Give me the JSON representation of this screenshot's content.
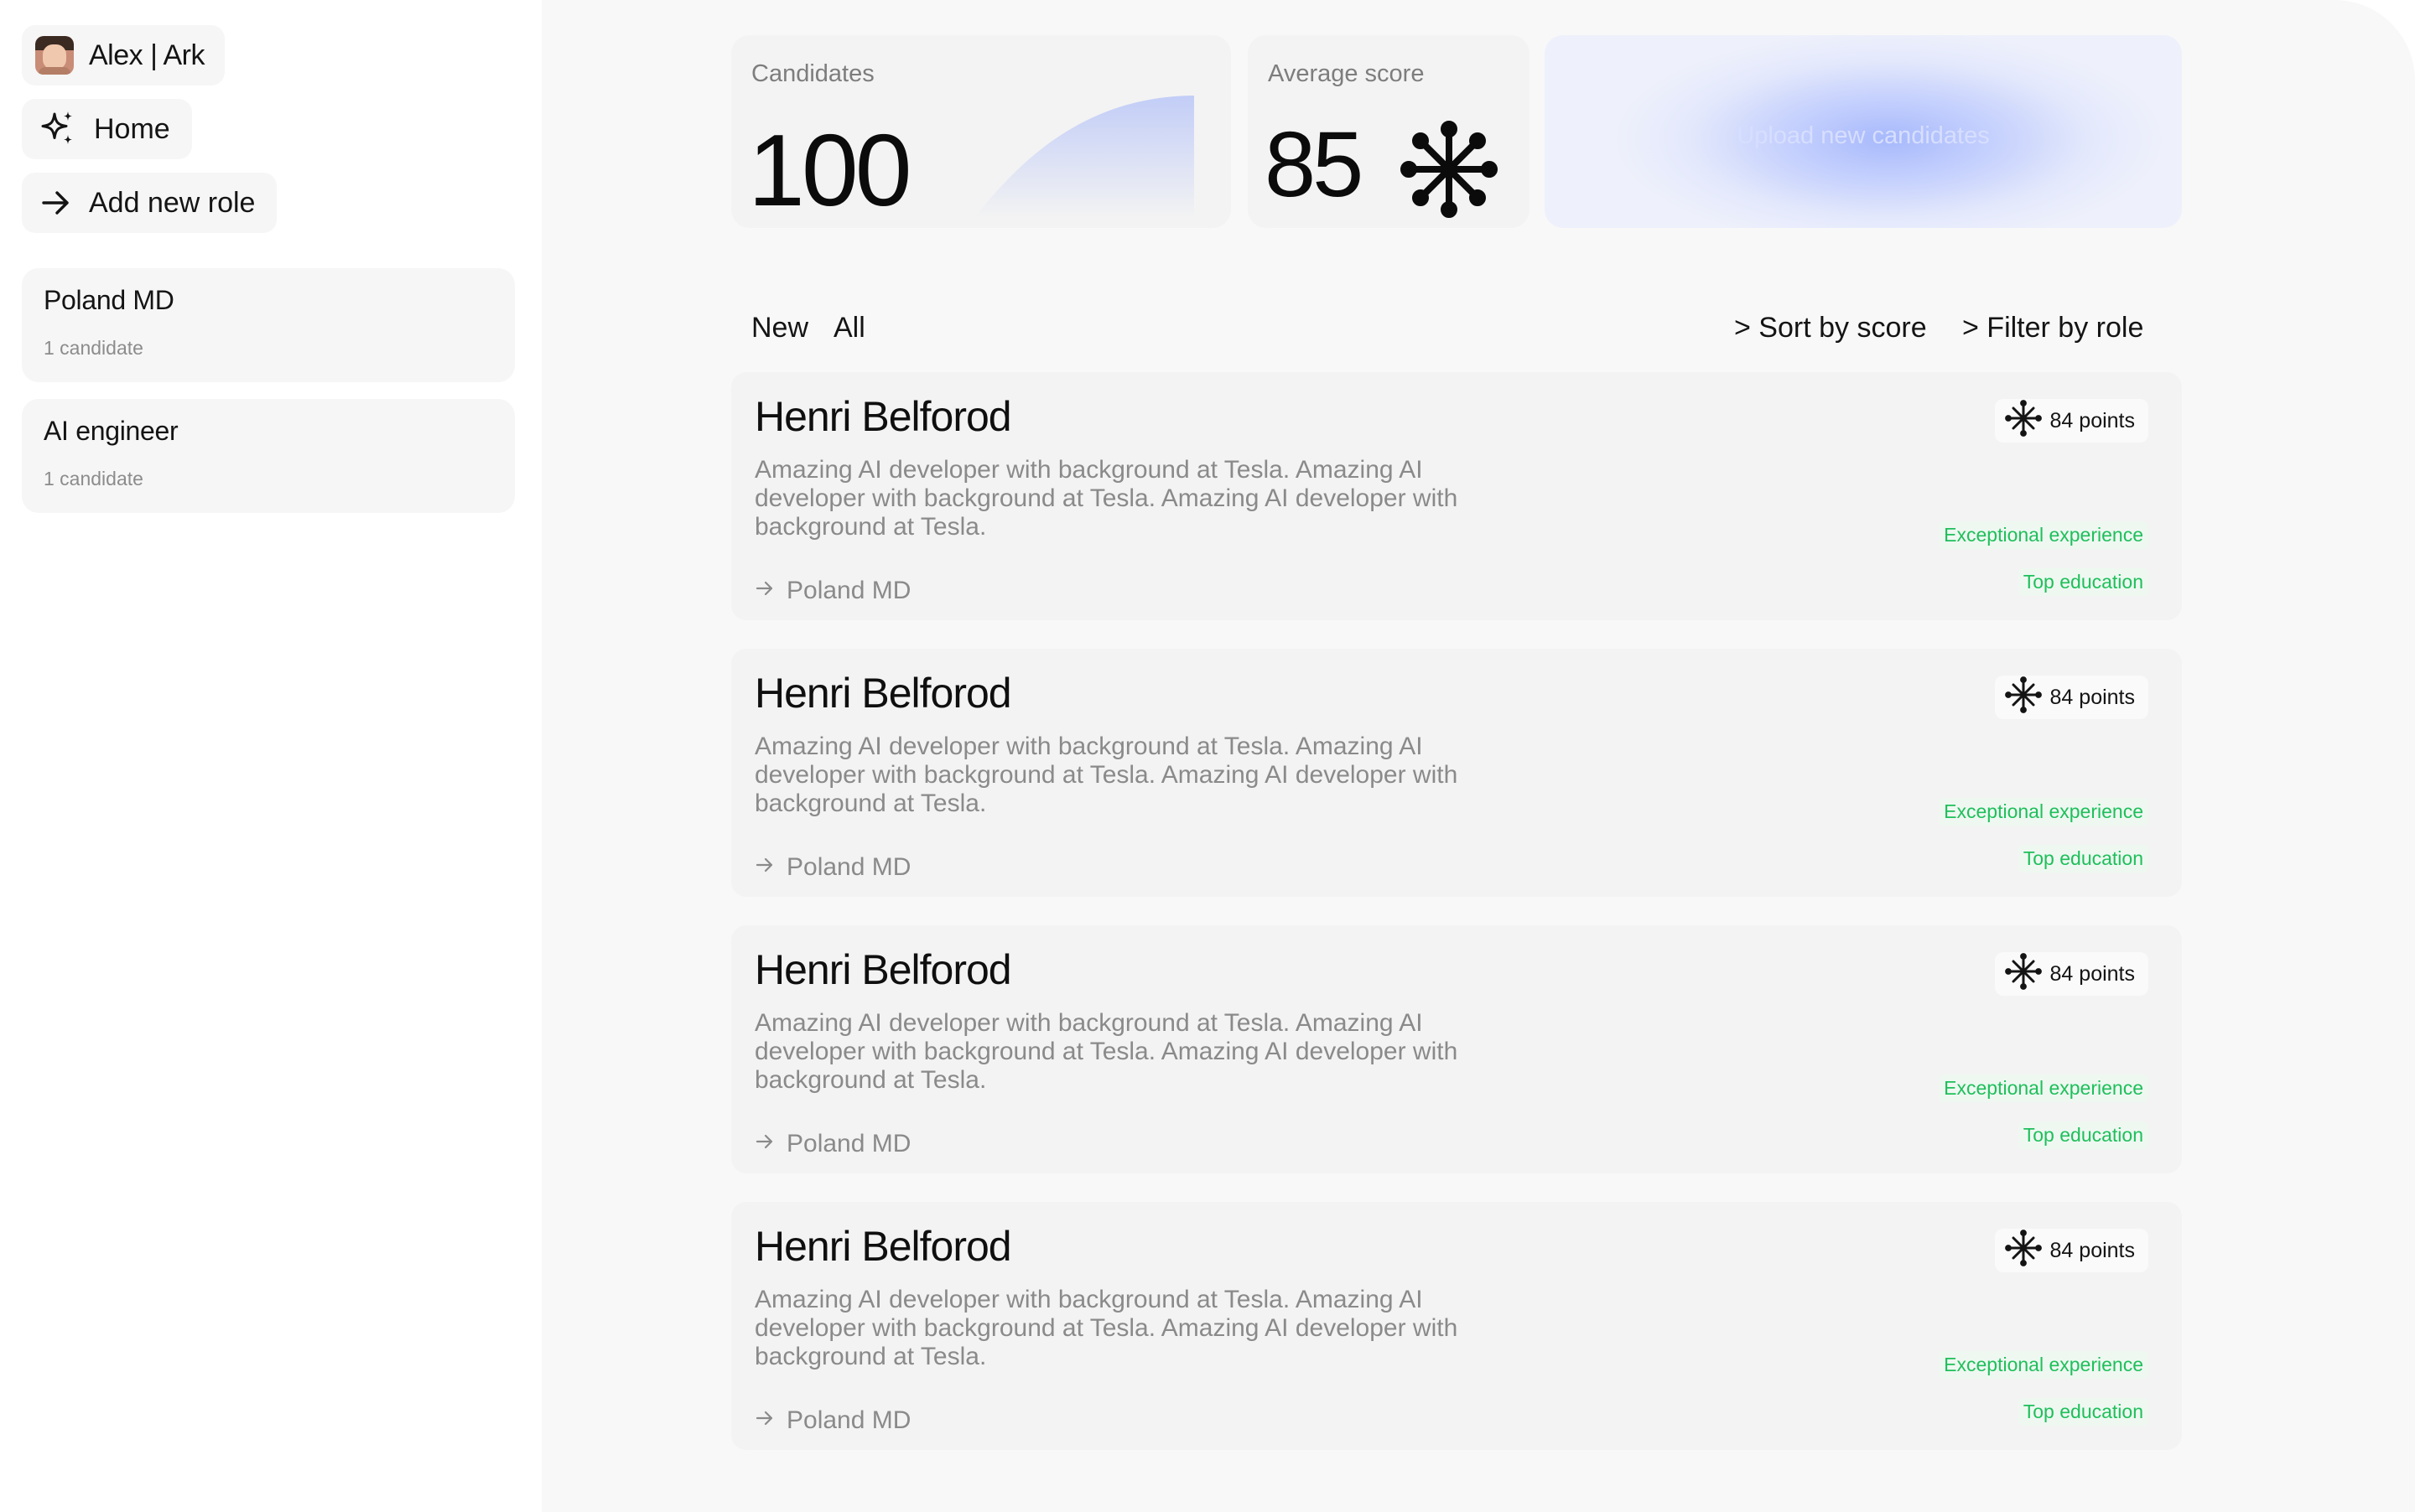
{
  "user": {
    "name": "Alex | Ark"
  },
  "nav": {
    "home_label": "Home",
    "add_role_label": "Add new role"
  },
  "roles": [
    {
      "title": "Poland MD",
      "count": "1 candidate"
    },
    {
      "title": "AI engineer",
      "count": "1 candidate"
    }
  ],
  "stats": {
    "candidates": {
      "label": "Candidates",
      "value": "100"
    },
    "average": {
      "label": "Average score",
      "value": "85"
    },
    "upload_label": "Upload new candidates"
  },
  "tabs": {
    "new_label": "New",
    "all_label": "All"
  },
  "toolbar": {
    "sort_label": "> Sort by score",
    "filter_label": "> Filter by role"
  },
  "candidates": [
    {
      "name": "Henri Belforod",
      "description": "Amazing AI developer with background at Tesla. Amazing AI developer with background at Tesla. Amazing AI developer with background at Tesla.",
      "role": "Poland MD",
      "points": "84 points",
      "tags": [
        "Exceptional experience",
        "Top education"
      ]
    },
    {
      "name": "Henri Belforod",
      "description": "Amazing AI developer with background at Tesla. Amazing AI developer with background at Tesla. Amazing AI developer with background at Tesla.",
      "role": "Poland MD",
      "points": "84 points",
      "tags": [
        "Exceptional experience",
        "Top education"
      ]
    },
    {
      "name": "Henri Belforod",
      "description": "Amazing AI developer with background at Tesla. Amazing AI developer with background at Tesla. Amazing AI developer with background at Tesla.",
      "role": "Poland MD",
      "points": "84 points",
      "tags": [
        "Exceptional experience",
        "Top education"
      ]
    },
    {
      "name": "Henri Belforod",
      "description": "Amazing AI developer with background at Tesla. Amazing AI developer with background at Tesla. Amazing AI developer with background at Tesla.",
      "role": "Poland MD",
      "points": "84 points",
      "tags": [
        "Exceptional experience",
        "Top education"
      ]
    }
  ],
  "colors": {
    "tag_green": "#1fbf5b",
    "upload_blue": "#a7b9fc",
    "text_muted": "#8a8a8a"
  },
  "icons": {
    "home": "sparkle-icon",
    "add_role": "arrow-right-icon",
    "score": "asterisk-icon",
    "role_link": "arrow-right-icon"
  }
}
